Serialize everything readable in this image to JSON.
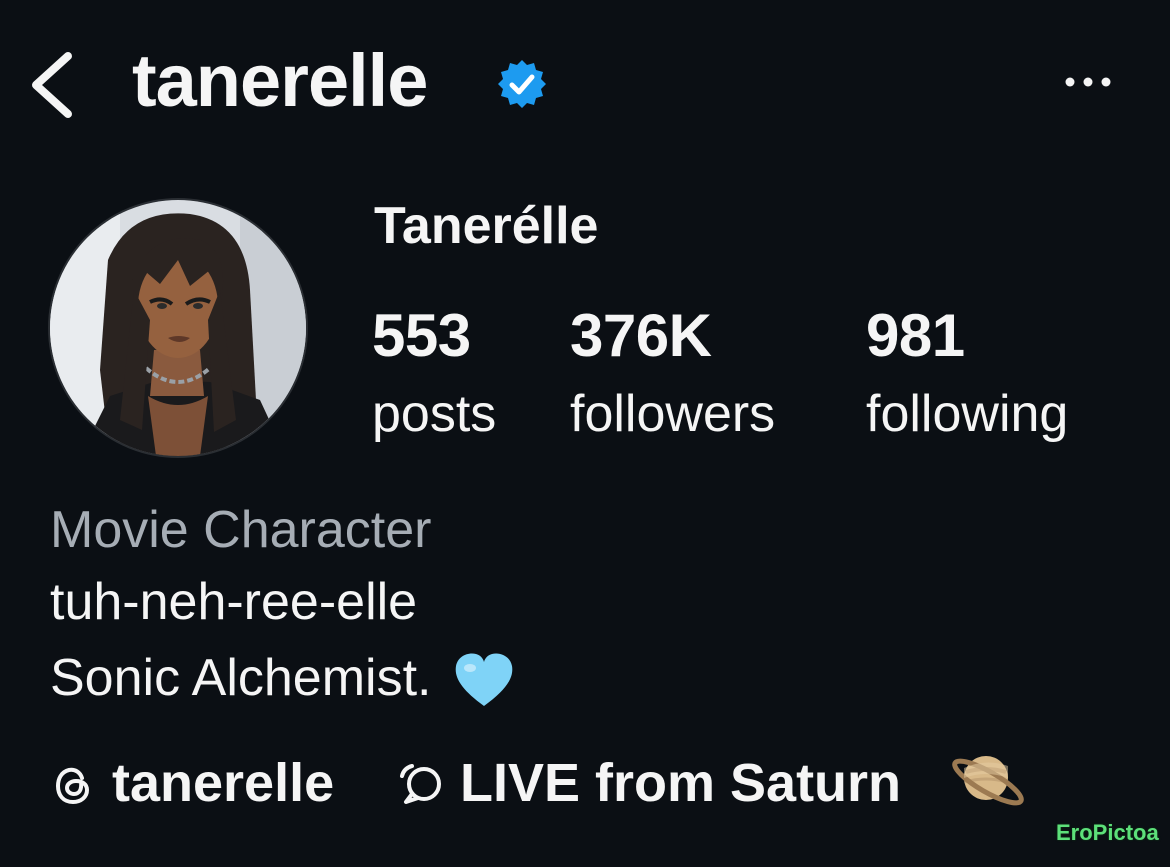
{
  "header": {
    "username": "tanerelle",
    "back_icon": "chevron-left-icon",
    "verified_icon": "verified-badge-icon",
    "more_icon": "ellipsis-icon"
  },
  "profile": {
    "display_name": "Tanerélle",
    "stats": {
      "posts": {
        "value": "553",
        "label": "posts"
      },
      "followers": {
        "value": "376K",
        "label": "followers"
      },
      "following": {
        "value": "981",
        "label": "following"
      }
    }
  },
  "bio": {
    "category": "Movie Character",
    "line1": "tuh-neh-ree-elle",
    "line2": "Sonic Alchemist."
  },
  "links": {
    "threads_handle": "tanerelle",
    "live_text": "LIVE from Saturn"
  },
  "colors": {
    "background": "#0b0f14",
    "verified": "#1d9bf0",
    "category_text": "#a6adb5",
    "heart": "#7fd3f7"
  },
  "watermark": "EroPictoa"
}
